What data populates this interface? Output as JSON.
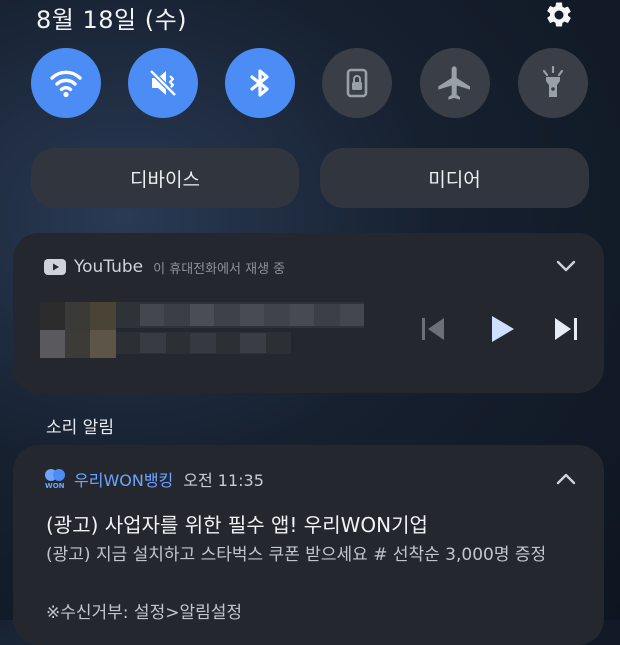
{
  "status": {
    "date": "8월 18일 (수)"
  },
  "quick_settings": [
    {
      "name": "wifi",
      "icon": "wifi-icon",
      "state": "on"
    },
    {
      "name": "sound",
      "icon": "vibrate-mute-icon",
      "state": "on"
    },
    {
      "name": "bluetooth",
      "icon": "bluetooth-icon",
      "state": "on"
    },
    {
      "name": "lock-rotation",
      "icon": "portrait-lock-icon",
      "state": "off"
    },
    {
      "name": "airplane",
      "icon": "airplane-icon",
      "state": "off"
    },
    {
      "name": "flashlight",
      "icon": "flashlight-icon",
      "state": "off"
    }
  ],
  "buttons": {
    "devices": "디바이스",
    "media": "미디어"
  },
  "media_player": {
    "app": "YouTube",
    "subtitle": "이 휴대전화에서 재생 중",
    "controls": [
      "previous-icon",
      "play-icon",
      "next-icon"
    ]
  },
  "section": {
    "label": "소리 알림"
  },
  "notification": {
    "app": "우리WON뱅킹",
    "time": "오전 11:35",
    "title": "(광고) 사업자를 위한 필수 앱! 우리WON기업",
    "body": "(광고) 지금 설치하고 스타벅스 쿠폰 받으세요 # 선착순 3,000명 증정",
    "footer": "※수신거부: 설정>알림설정",
    "icon_label": "WON"
  },
  "colors": {
    "accent": "#4c8cf5",
    "card": "#24282e",
    "app_link": "#6ea4ff"
  }
}
